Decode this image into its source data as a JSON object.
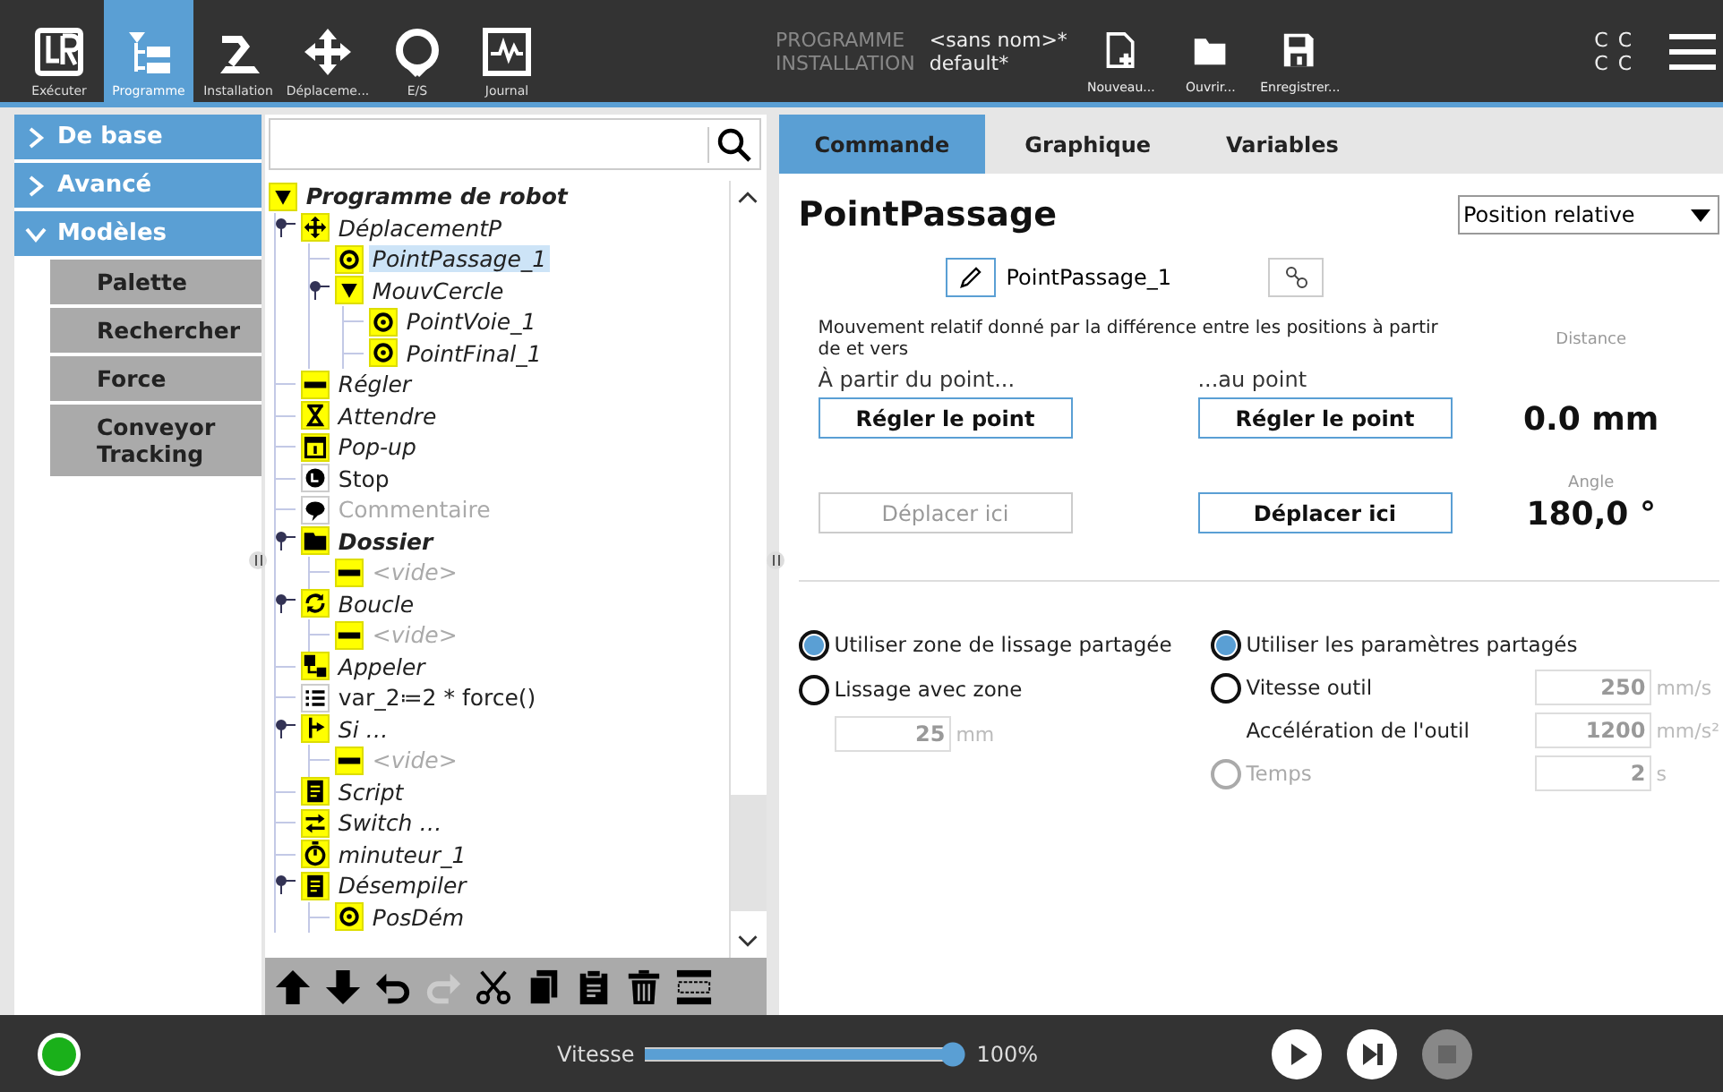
{
  "header": {
    "nav": [
      {
        "label": "Exécuter",
        "kind": "logo",
        "selected": false
      },
      {
        "label": "Programme",
        "kind": "program",
        "selected": true
      },
      {
        "label": "Installation",
        "kind": "arm",
        "selected": false
      },
      {
        "label": "Déplaceme...",
        "kind": "move",
        "selected": false
      },
      {
        "label": "E/S",
        "kind": "io",
        "selected": false
      },
      {
        "label": "Journal",
        "kind": "log",
        "selected": false
      }
    ],
    "info": [
      {
        "label": "PROGRAMME",
        "value": "<sans nom>*"
      },
      {
        "label": "INSTALLATION",
        "value": "default*"
      }
    ],
    "file_buttons": [
      {
        "label": "Nouveau...",
        "kind": "new"
      },
      {
        "label": "Ouvrir...",
        "kind": "open"
      },
      {
        "label": "Enregistrer...",
        "kind": "save"
      }
    ],
    "status_text": [
      "C C",
      "C C"
    ]
  },
  "sidebar": [
    {
      "label": "De base",
      "expanded": false
    },
    {
      "label": "Avancé",
      "expanded": false
    },
    {
      "label": "Modèles",
      "expanded": true,
      "children": [
        "Palette",
        "Rechercher",
        "Force",
        "Conveyor Tracking"
      ]
    }
  ],
  "tree": {
    "nodes": [
      {
        "label": "Programme de robot",
        "kind": "flag",
        "bold": true,
        "italic": true,
        "disabled": false,
        "selected": false,
        "children": [
          {
            "label": "DéplacementP",
            "kind": "move",
            "bold": false,
            "italic": true,
            "disabled": false,
            "selected": false,
            "expanded": true,
            "children": [
              {
                "label": "PointPassage_1",
                "kind": "target",
                "bold": false,
                "italic": true,
                "disabled": false,
                "selected": true
              },
              {
                "label": "MouvCercle",
                "kind": "flag",
                "bold": false,
                "italic": true,
                "disabled": false,
                "selected": false,
                "expanded": true,
                "children": [
                  {
                    "label": "PointVoie_1",
                    "kind": "target",
                    "bold": false,
                    "italic": true,
                    "disabled": false,
                    "selected": false
                  },
                  {
                    "label": "PointFinal_1",
                    "kind": "target",
                    "bold": false,
                    "italic": true,
                    "disabled": false,
                    "selected": false
                  }
                ]
              }
            ]
          },
          {
            "label": "Régler",
            "kind": "bar",
            "bold": false,
            "italic": true,
            "disabled": false,
            "selected": false
          },
          {
            "label": "Attendre",
            "kind": "hourglass",
            "bold": false,
            "italic": true,
            "disabled": false,
            "selected": false
          },
          {
            "label": "Pop-up",
            "kind": "popup",
            "bold": false,
            "italic": true,
            "disabled": false,
            "selected": false
          },
          {
            "label": "Stop",
            "kind": "stop",
            "bold": false,
            "italic": false,
            "disabled": false,
            "selected": false
          },
          {
            "label": "Commentaire",
            "kind": "comment",
            "bold": false,
            "italic": false,
            "disabled": true,
            "selected": false
          },
          {
            "label": "Dossier",
            "kind": "folder",
            "bold": true,
            "italic": true,
            "disabled": false,
            "selected": false,
            "expanded": true,
            "children": [
              {
                "label": "<vide>",
                "kind": "bar",
                "bold": false,
                "italic": true,
                "disabled": true,
                "selected": false
              }
            ]
          },
          {
            "label": "Boucle",
            "kind": "loop",
            "bold": false,
            "italic": true,
            "disabled": false,
            "selected": false,
            "expanded": true,
            "children": [
              {
                "label": "<vide>",
                "kind": "bar",
                "bold": false,
                "italic": true,
                "disabled": true,
                "selected": false
              }
            ]
          },
          {
            "label": "Appeler",
            "kind": "call",
            "bold": false,
            "italic": true,
            "disabled": false,
            "selected": false
          },
          {
            "label": "var_2≔2 * force()",
            "kind": "list",
            "bold": false,
            "italic": false,
            "disabled": false,
            "selected": false
          },
          {
            "label": "Si …",
            "kind": "branch",
            "bold": false,
            "italic": true,
            "disabled": false,
            "selected": false,
            "expanded": true,
            "children": [
              {
                "label": "<vide>",
                "kind": "bar",
                "bold": false,
                "italic": true,
                "disabled": true,
                "selected": false
              }
            ]
          },
          {
            "label": "Script",
            "kind": "script",
            "bold": false,
            "italic": true,
            "disabled": false,
            "selected": false
          },
          {
            "label": "Switch …",
            "kind": "switch",
            "bold": false,
            "italic": true,
            "disabled": false,
            "selected": false
          },
          {
            "label": "minuteur_1",
            "kind": "timer",
            "bold": false,
            "italic": true,
            "disabled": false,
            "selected": false
          },
          {
            "label": "Désempiler",
            "kind": "script",
            "bold": false,
            "italic": true,
            "disabled": false,
            "selected": false,
            "expanded": true,
            "children": [
              {
                "label": "PosDém",
                "kind": "target",
                "bold": false,
                "italic": true,
                "disabled": false,
                "selected": false
              }
            ]
          }
        ]
      }
    ],
    "toolbar": [
      {
        "kind": "up",
        "disabled": false
      },
      {
        "kind": "down",
        "disabled": false
      },
      {
        "kind": "undo",
        "disabled": false
      },
      {
        "kind": "redo",
        "disabled": true
      },
      {
        "kind": "cut",
        "disabled": false
      },
      {
        "kind": "copy",
        "disabled": false
      },
      {
        "kind": "paste",
        "disabled": false
      },
      {
        "kind": "trash",
        "disabled": false
      },
      {
        "kind": "suppress",
        "disabled": false
      }
    ]
  },
  "tabs": [
    {
      "label": "Commande",
      "selected": true
    },
    {
      "label": "Graphique",
      "selected": false
    },
    {
      "label": "Variables",
      "selected": false
    }
  ],
  "command": {
    "title": "PointPassage",
    "dropdown": "Position relative",
    "name": "PointPassage_1",
    "description": "Mouvement relatif donné par la différence entre les positions à partir de et vers",
    "from_label": "À partir du point...",
    "to_label": "...au point",
    "from_buttons": [
      {
        "label": "Régler le point",
        "disabled": false
      },
      {
        "label": "Déplacer ici",
        "disabled": true
      }
    ],
    "to_buttons": [
      {
        "label": "Régler le point",
        "disabled": false
      },
      {
        "label": "Déplacer ici",
        "disabled": false
      }
    ],
    "readouts": [
      {
        "label": "Distance",
        "value": "0.0 mm"
      },
      {
        "label": "Angle",
        "value": "180,0 °"
      }
    ],
    "blend": [
      {
        "kind": "radio",
        "label": "Utiliser zone de lissage partagée",
        "selected": true,
        "disabled": false
      },
      {
        "kind": "radio",
        "label": "Lissage avec zone",
        "selected": false,
        "disabled": false
      },
      {
        "kind": "field",
        "value": "25",
        "unit": "mm",
        "disabled": true
      }
    ],
    "speed": [
      {
        "kind": "radio",
        "label": "Utiliser les paramètres partagés",
        "selected": true,
        "disabled": false
      },
      {
        "kind": "radio",
        "label": "Vitesse outil",
        "selected": false,
        "disabled": false,
        "value": "250",
        "unit": "mm/s",
        "field_disabled": true
      },
      {
        "kind": "plain",
        "label": "Accélération de l'outil",
        "value": "1200",
        "unit": "mm/s²",
        "field_disabled": true
      },
      {
        "kind": "radio",
        "label": "Temps",
        "selected": false,
        "disabled": true,
        "value": "2",
        "unit": "s",
        "field_disabled": true
      }
    ]
  },
  "footer": {
    "speed_label": "Vitesse",
    "speed": {
      "level": 1.0
    },
    "speed_reading": "100%",
    "controls": [
      {
        "kind": "play",
        "disabled": false
      },
      {
        "kind": "step",
        "disabled": false
      },
      {
        "kind": "stop",
        "disabled": true
      }
    ]
  }
}
